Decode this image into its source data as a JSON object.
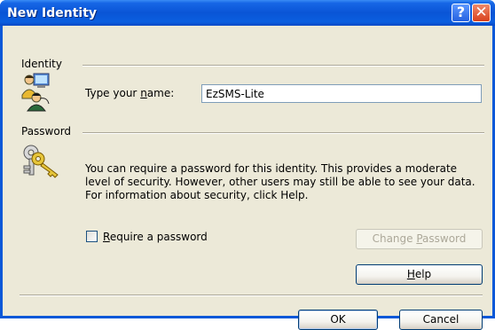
{
  "window": {
    "title": "New Identity"
  },
  "titlebar": {
    "help_glyph": "?",
    "close_glyph": "✕"
  },
  "identity": {
    "group_label": "Identity",
    "name_label_before": "Type your ",
    "name_label_accel": "n",
    "name_label_after": "ame:",
    "name_value": "EzSMS-Lite",
    "icon": "users-computer-icon"
  },
  "password": {
    "group_label": "Password",
    "description": "You can require a password for this identity.  This provides a moderate level of security. However, other users may still be able to see your data. For information about security, click Help.",
    "checkbox_accel": "R",
    "checkbox_rest": "equire a password",
    "checkbox_checked": false,
    "change_before": "Change ",
    "change_accel": "P",
    "change_after": "assword",
    "icon": "keys-icon"
  },
  "buttons": {
    "help_accel": "H",
    "help_rest": "elp",
    "ok": "OK",
    "cancel": "Cancel"
  },
  "colors": {
    "titlebar": "#0a55d6",
    "dialog_bg": "#ece9d8",
    "close_button": "#d8401c"
  }
}
